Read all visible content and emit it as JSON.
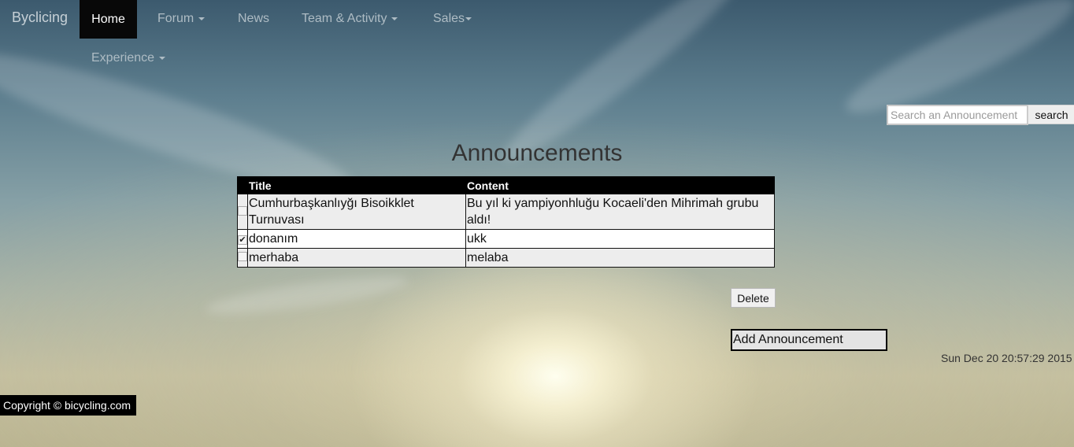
{
  "navbar": {
    "brand": "Byclicing",
    "items": [
      {
        "label": "Home"
      },
      {
        "label": "Forum"
      },
      {
        "label": "News"
      },
      {
        "label": "Team & Activity"
      },
      {
        "label": "Sales"
      },
      {
        "label": "Experience"
      }
    ]
  },
  "search": {
    "placeholder": "Search an Announcement",
    "button_label": "search"
  },
  "page": {
    "title": "Announcements"
  },
  "table": {
    "columns": [
      "Title",
      "Content"
    ],
    "rows": [
      {
        "checked": false,
        "title": "Cumhurbaşkanlıyğı Bisoikklet Turnuvası",
        "content": "Bu yıl ki yampiyonhluğu Kocaeli'den Mihrimah grubu aldı!"
      },
      {
        "checked": true,
        "title": "donanım",
        "content": "ukk"
      },
      {
        "checked": false,
        "title": "merhaba",
        "content": "melaba"
      }
    ]
  },
  "actions": {
    "delete_label": "Delete",
    "add_label": "Add Announcement"
  },
  "datetime": "Sun Dec 20 20:57:29 2015",
  "footer": {
    "copyright": "Copyright © bicycling.com"
  }
}
